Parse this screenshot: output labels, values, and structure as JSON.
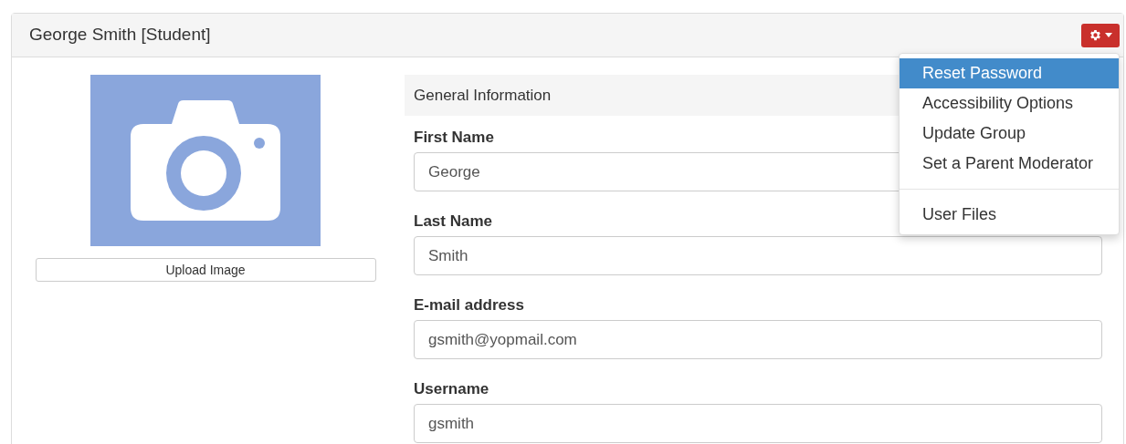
{
  "panel": {
    "title": "George Smith [Student]"
  },
  "actions_menu": {
    "open": true,
    "items": [
      {
        "kind": "item",
        "label": "Reset Password",
        "selected": true
      },
      {
        "kind": "item",
        "label": "Accessibility Options",
        "selected": false
      },
      {
        "kind": "item",
        "label": "Update Group",
        "selected": false
      },
      {
        "kind": "item",
        "label": "Set a Parent Moderator",
        "selected": false
      },
      {
        "kind": "divider"
      },
      {
        "kind": "item",
        "label": "User Files",
        "selected": false
      }
    ]
  },
  "profile_image": {
    "button": "Upload Image"
  },
  "section": {
    "title": "General Information"
  },
  "fields": [
    {
      "label": "First Name",
      "value": "George"
    },
    {
      "label": "Last Name",
      "value": "Smith"
    },
    {
      "label": "E-mail address",
      "value": "gsmith@yopmail.com"
    },
    {
      "label": "Username",
      "value": "gsmith"
    }
  ]
}
